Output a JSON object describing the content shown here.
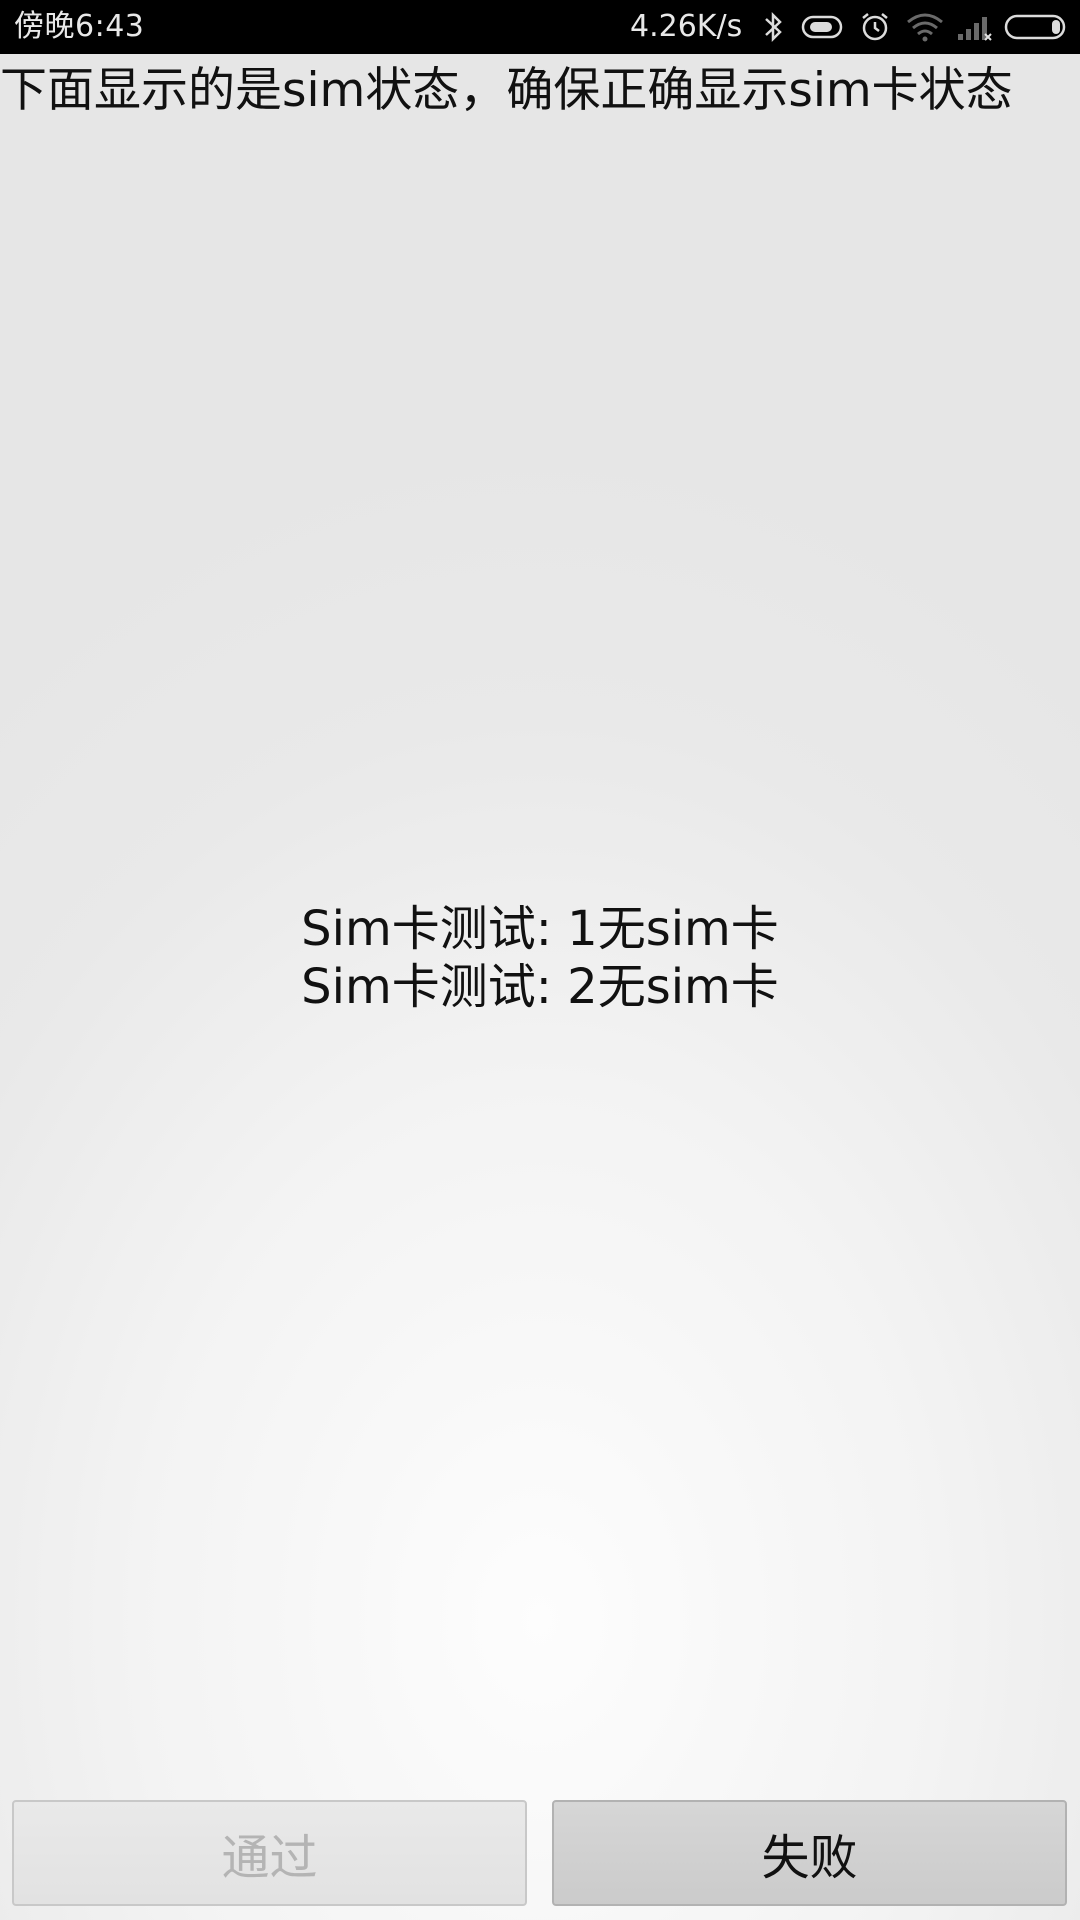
{
  "status_bar": {
    "time": "傍晚6:43",
    "network_speed": "4.26K/s",
    "icons": [
      "bluetooth-icon",
      "vibrate-icon",
      "alarm-icon",
      "wifi-icon",
      "signal-icon",
      "battery-icon"
    ]
  },
  "header": {
    "message": "下面显示的是sim状态，确保正确显示sim卡状态"
  },
  "sim_test": {
    "line1": "Sim卡测试: 1无sim卡",
    "line2": "Sim卡测试: 2无sim卡"
  },
  "buttons": {
    "pass_label": "通过",
    "fail_label": "失败"
  },
  "colors": {
    "status_bar_bg": "#000000",
    "pass_disabled_text": "#b4b4b4",
    "fail_text": "#111111"
  }
}
